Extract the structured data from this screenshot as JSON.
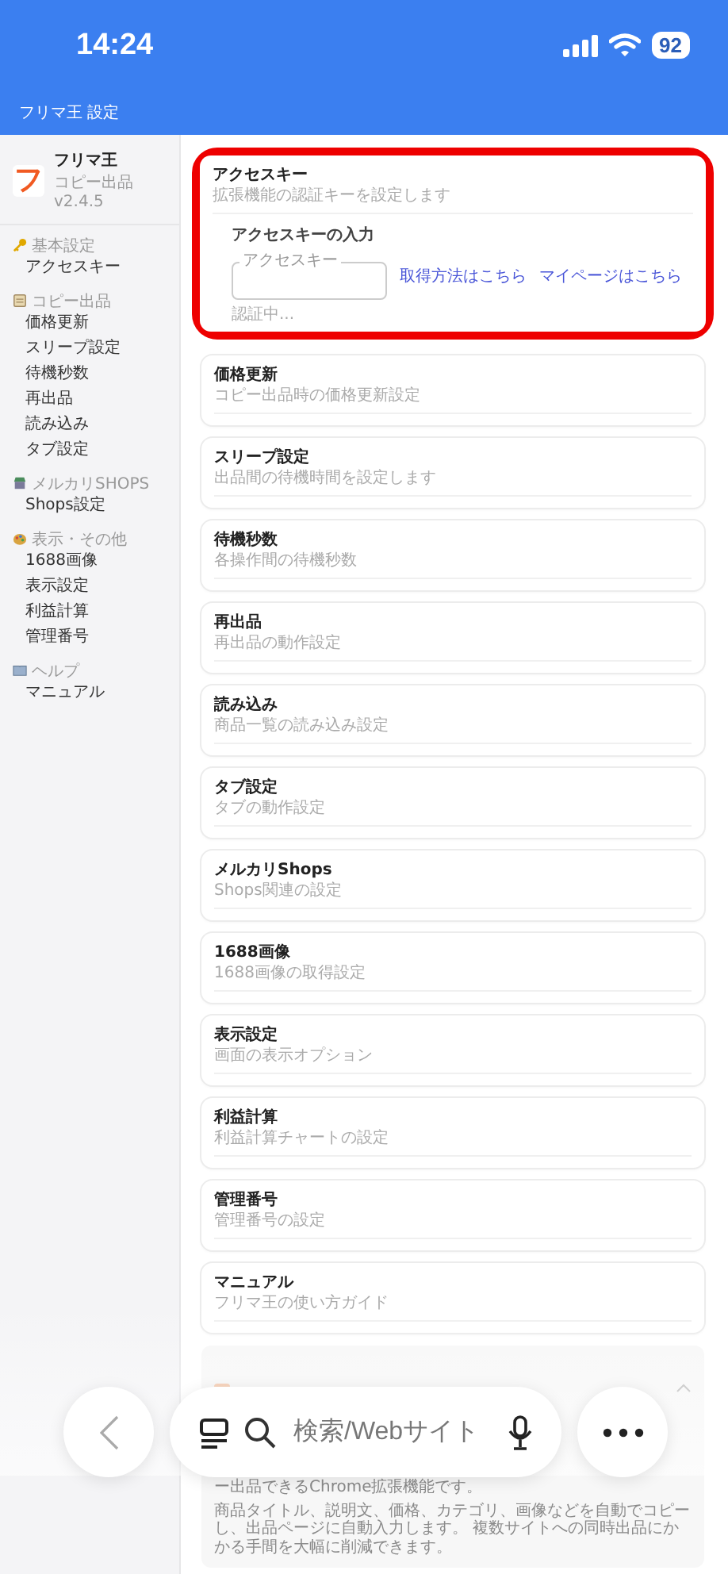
{
  "status_bar": {
    "time": "14:24",
    "battery": "92"
  },
  "header": {
    "title": "フリマ王 設定"
  },
  "sidebar": {
    "logo_glyph": "フ",
    "app_name": "フリマ王",
    "version": "コピー出品 v2.4.5",
    "groups": [
      {
        "kind": "key",
        "label": "基本設定",
        "items": [
          {
            "label": "アクセスキー",
            "selected": false
          }
        ]
      },
      {
        "kind": "note",
        "label": "コピー出品",
        "items": [
          {
            "label": "価格更新",
            "selected": false
          },
          {
            "label": "スリープ設定",
            "selected": false
          },
          {
            "label": "待機秒数",
            "selected": false
          },
          {
            "label": "再出品",
            "selected": false
          },
          {
            "label": "読み込み",
            "selected": false
          },
          {
            "label": "タブ設定",
            "selected": false
          }
        ]
      },
      {
        "kind": "store",
        "label": "メルカリSHOPS",
        "items": [
          {
            "label": "Shops設定",
            "selected": false
          }
        ]
      },
      {
        "kind": "palette",
        "label": "表示・その他",
        "items": [
          {
            "label": "1688画像",
            "selected": false
          },
          {
            "label": "表示設定",
            "selected": false
          },
          {
            "label": "利益計算",
            "selected": false
          },
          {
            "label": "管理番号",
            "selected": false
          }
        ]
      },
      {
        "kind": "book",
        "label": "ヘルプ",
        "items": [
          {
            "label": "マニュアル",
            "selected": false
          }
        ]
      }
    ]
  },
  "access_card": {
    "title": "アクセスキー",
    "subtitle": "拡張機能の認証キーを設定します",
    "highlighted": true,
    "section_title": "アクセスキーの入力",
    "field": {
      "label": "アクセスキー"
    },
    "status": "認証中...",
    "links": [
      "取得方法はこちら",
      "マイページはこちら"
    ]
  },
  "cards": [
    {
      "title": "価格更新",
      "subtitle": "コピー出品時の価格更新設定"
    },
    {
      "title": "スリープ設定",
      "subtitle": "出品間の待機時間を設定します"
    },
    {
      "title": "待機秒数",
      "subtitle": "各操作間の待機秒数"
    },
    {
      "title": "再出品",
      "subtitle": "再出品の動作設定"
    },
    {
      "title": "読み込み",
      "subtitle": "商品一覧の読み込み設定"
    },
    {
      "title": "タブ設定",
      "subtitle": "タブの動作設定"
    },
    {
      "title": "メルカリShops",
      "subtitle": "Shops関連の設定"
    },
    {
      "title": "1688画像",
      "subtitle": "1688画像の取得設定"
    },
    {
      "title": "表示設定",
      "subtitle": "画面の表示オプション"
    },
    {
      "title": "利益計算",
      "subtitle": "利益計算チャートの設定"
    },
    {
      "title": "管理番号",
      "subtitle": "管理番号の設定"
    },
    {
      "title": "マニュアル",
      "subtitle": "フリマ王の使い方ガイド"
    }
  ],
  "manual_panel": {
    "expanded": true,
    "paragraphs": [
      "ー出品できるChrome拡張機能です。",
      "商品タイトル、説明文、価格、カテゴリ、画像などを自動でコピーし、出品ページに自動入力します。 複数サイトへの同時出品にかかる手間を大幅に削減できます。"
    ]
  },
  "browser_bar": {
    "placeholder": "検索/Webサイト"
  }
}
